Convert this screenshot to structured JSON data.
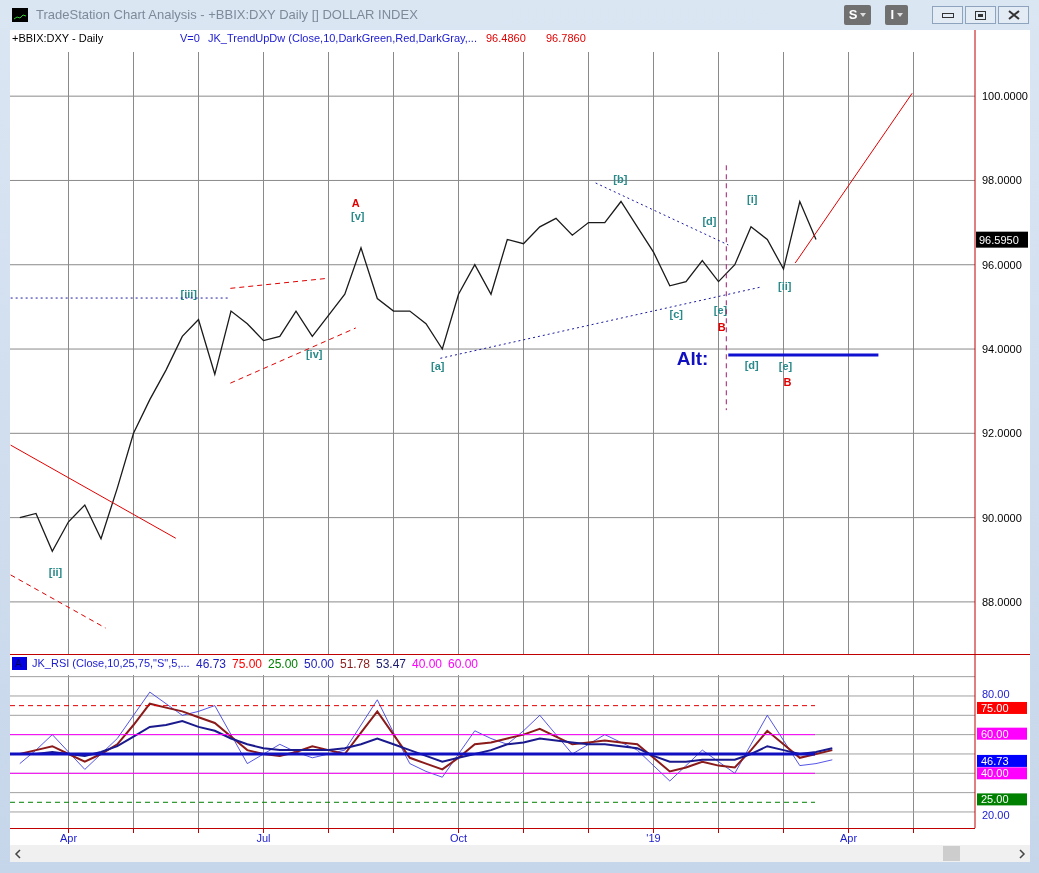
{
  "window": {
    "title": "TradeStation Chart Analysis - +BBIX:DXY Daily [] DOLLAR INDEX"
  },
  "toolbar_buttons": [
    {
      "label": "S"
    },
    {
      "label": "I"
    }
  ],
  "price_panel": {
    "symbol": "+BBIX:DXY - Daily",
    "volume": "V=0",
    "indicator": "JK_TrendUpDw (Close,10,DarkGreen,Red,DarkGray,...",
    "indicator_values": [
      "96.4860",
      "96.7860"
    ],
    "last_price": "96.5950",
    "chart_data": {
      "type": "line",
      "grid": true,
      "ylim": [
        86.74,
        101.57
      ],
      "yticks": [
        {
          "value": 100,
          "label": "100.0000"
        },
        {
          "value": 98,
          "label": "98.0000"
        },
        {
          "value": 96,
          "label": "96.0000"
        },
        {
          "value": 94,
          "label": "94.0000"
        },
        {
          "value": 92,
          "label": "92.0000"
        },
        {
          "value": 90,
          "label": "90.0000"
        },
        {
          "value": 88,
          "label": "88.0000"
        }
      ],
      "categories": [
        null,
        null,
        null,
        null,
        null,
        null,
        null,
        null,
        null,
        null,
        null,
        null,
        null,
        null,
        null,
        null,
        null,
        null,
        null,
        null,
        null,
        null,
        null,
        null,
        null,
        null,
        null,
        null,
        null,
        null,
        null,
        null,
        null,
        null,
        null,
        null,
        null,
        null,
        null,
        null,
        null,
        null,
        null,
        null,
        null,
        null,
        null,
        null,
        null,
        null,
        null,
        null,
        null,
        null,
        null,
        null,
        null,
        null,
        null
      ],
      "series": [
        {
          "color": "#1a1a1a",
          "values": [
            90.0,
            90.1,
            89.2,
            89.9,
            90.3,
            89.5,
            90.7,
            92.0,
            92.8,
            93.5,
            94.3,
            94.7,
            93.4,
            94.9,
            94.6,
            94.2,
            94.3,
            94.9,
            94.3,
            94.8,
            95.3,
            96.4,
            95.2,
            94.9,
            94.9,
            94.6,
            94.0,
            95.3,
            96.0,
            95.3,
            96.6,
            96.5,
            96.9,
            97.1,
            96.7,
            97.0,
            97.0,
            97.5,
            96.9,
            96.3,
            95.5,
            95.6,
            96.1,
            95.6,
            96.0,
            96.9,
            96.6,
            95.9,
            97.5,
            96.6,
            null,
            null,
            null,
            null,
            null,
            null,
            null,
            null,
            null
          ]
        }
      ],
      "annotations": [
        "[ii]",
        "[iii]",
        "[iv]",
        "A",
        "[v]",
        "[a]",
        "[b]",
        "[c]",
        "[d]",
        "[e]",
        "B",
        "[i]",
        "[ii]",
        "Alt:",
        "[d]",
        "[e]",
        "B"
      ]
    }
  },
  "rsi_panel": {
    "badge": "A",
    "indicator": "JK_RSI (Close,10,25,75,\"S\",5,...",
    "indicator_values": [
      {
        "text": "46.73",
        "color": "#2020c0"
      },
      {
        "text": "75.00",
        "color": "#ff0000"
      },
      {
        "text": "25.00",
        "color": "#008000"
      },
      {
        "text": "50.00",
        "color": "#2020c0"
      },
      {
        "text": "51.78",
        "color": "#8b1a1a"
      },
      {
        "text": "53.47",
        "color": "#1a1a6e"
      },
      {
        "text": "40.00",
        "color": "#ff00ff"
      },
      {
        "text": "60.00",
        "color": "#ff00ff"
      }
    ],
    "chart_data": {
      "type": "line",
      "grid": true,
      "ylim": [
        11.7,
        101.2
      ],
      "yticks": [
        {
          "value": 80,
          "label": "80.00"
        },
        {
          "value": 20,
          "label": "20.00"
        }
      ],
      "categories": [
        null,
        null,
        null,
        "Apr",
        null,
        null,
        null,
        null,
        null,
        null,
        null,
        null,
        null,
        null,
        null,
        "Jul",
        null,
        null,
        null,
        null,
        null,
        null,
        null,
        null,
        null,
        null,
        null,
        "Oct",
        null,
        null,
        null,
        null,
        null,
        null,
        null,
        null,
        null,
        null,
        null,
        "'19",
        null,
        null,
        null,
        null,
        null,
        null,
        null,
        null,
        null,
        null,
        null,
        "Apr",
        null,
        null,
        null,
        null,
        null,
        null,
        null
      ],
      "series": [
        {
          "color": "#2a2ae0",
          "values": [
            45,
            52,
            60,
            51,
            42,
            50,
            58,
            70,
            82,
            76,
            70,
            72,
            75,
            60,
            45,
            50,
            55,
            51,
            48,
            50,
            52,
            65,
            78,
            61,
            45,
            41,
            38,
            50,
            62,
            58,
            55,
            62,
            70,
            60,
            50,
            55,
            60,
            56,
            52,
            44,
            36,
            44,
            52,
            46,
            40,
            55,
            70,
            57,
            44,
            45,
            47,
            null,
            null,
            null,
            null,
            null,
            null,
            null,
            null
          ]
        },
        {
          "color": "#8b1a1a",
          "values": [
            50,
            52,
            54,
            50,
            46,
            50,
            55,
            65,
            76,
            74,
            72,
            69,
            66,
            59,
            52,
            50,
            49,
            51,
            54,
            52,
            50,
            61,
            72,
            60,
            48,
            45,
            42,
            48,
            55,
            56,
            58,
            60,
            63,
            59,
            55,
            56,
            57,
            56,
            55,
            48,
            41,
            43,
            46,
            44,
            43,
            52,
            62,
            55,
            48,
            50,
            52,
            null,
            null,
            null,
            null,
            null,
            null,
            null,
            null
          ]
        },
        {
          "color": "#1a1a8e",
          "values": [
            50,
            50,
            51,
            50,
            49,
            51,
            54,
            59,
            64,
            65,
            67,
            64,
            62,
            58,
            55,
            53,
            52,
            52,
            52,
            52,
            53,
            55,
            58,
            55,
            52,
            49,
            46,
            48,
            50,
            52,
            55,
            56,
            58,
            57,
            56,
            55,
            55,
            54,
            53,
            49,
            46,
            46,
            47,
            47,
            47,
            50,
            54,
            52,
            50,
            51,
            53,
            null,
            null,
            null,
            null,
            null,
            null,
            null,
            null
          ]
        }
      ],
      "annotations": [
        "75.00",
        "60.00",
        "46.73",
        "40.00",
        "25.00"
      ]
    }
  }
}
